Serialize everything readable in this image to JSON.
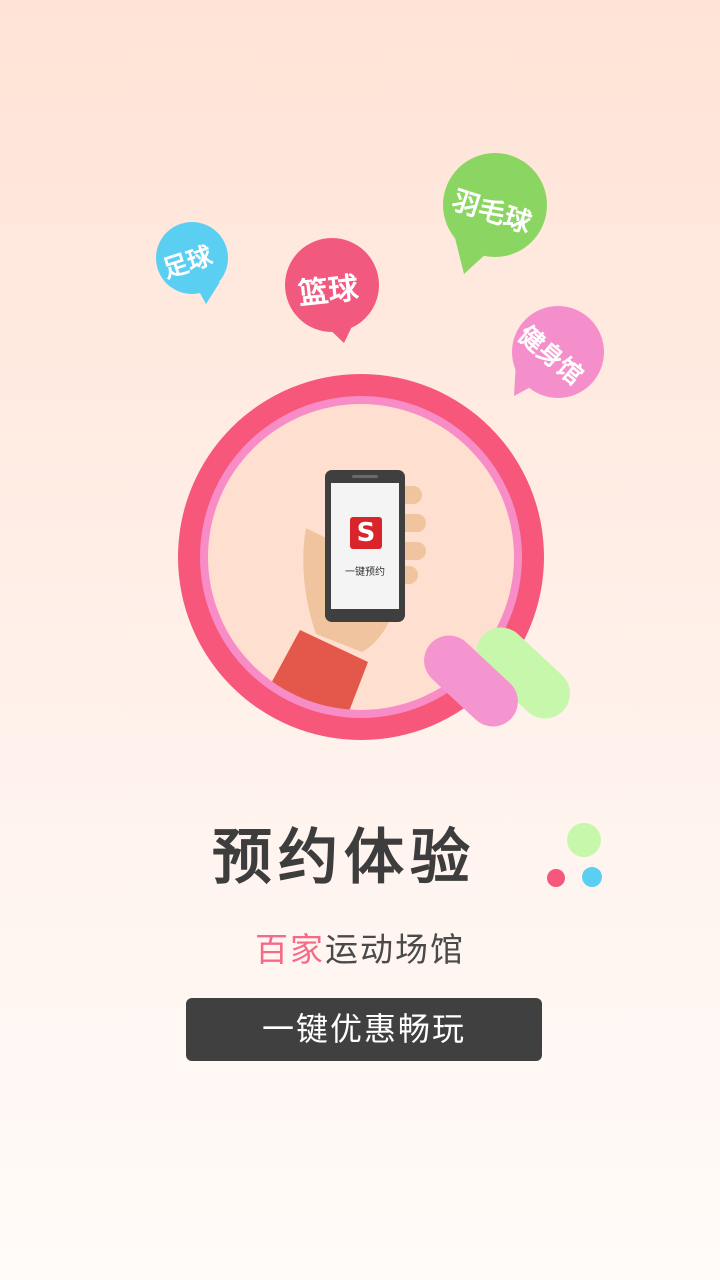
{
  "bubbles": {
    "soccer": {
      "label": "足球",
      "color": "#5BCFF2"
    },
    "basketball": {
      "label": "篮球",
      "color": "#F2597F"
    },
    "badminton": {
      "label": "羽毛球",
      "color": "#8BD663"
    },
    "gym": {
      "label": "健身馆",
      "color": "#F58FCB"
    }
  },
  "phone": {
    "app_label": "一键预约",
    "logo_letter": "S"
  },
  "headline": "预约体验",
  "subline": {
    "highlight": "百家",
    "rest": "运动场馆"
  },
  "cta_label": "一键优惠畅玩",
  "colors": {
    "ring_outer": "#F7577A",
    "ring_inner": "#F78CC6",
    "circle_fill": "#FFDFD0",
    "sleeve": "#E3584A",
    "skin": "#EFC49E",
    "phone_body": "#3F3F3F",
    "logo_red": "#D9242B",
    "pill_pink": "#F595CF",
    "pill_green": "#C6F7AA",
    "dot_green": "#C6F7AA",
    "dot_pink": "#F7577A",
    "dot_blue": "#5BCFF2"
  }
}
